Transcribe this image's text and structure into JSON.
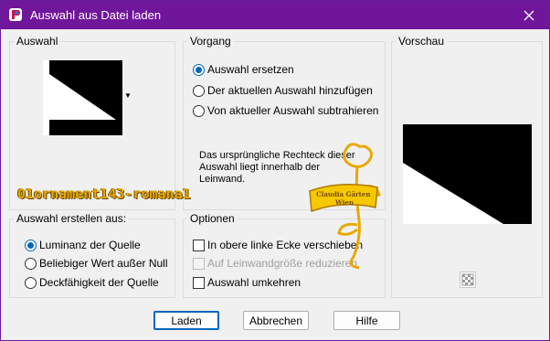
{
  "window": {
    "title": "Auswahl aus Datei laden"
  },
  "groups": {
    "auswahl": {
      "title": "Auswahl"
    },
    "vorgang": {
      "title": "Vorgang",
      "options": [
        {
          "label": "Auswahl ersetzen",
          "checked": true
        },
        {
          "label": "Der aktuellen Auswahl hinzufügen",
          "checked": false
        },
        {
          "label": "Von aktueller Auswahl subtrahieren",
          "checked": false
        }
      ],
      "info": "Das ursprüngliche Rechteck dieser Auswahl liegt innerhalb der Leinwand."
    },
    "vorschau": {
      "title": "Vorschau"
    },
    "erstellen": {
      "title": "Auswahl erstellen aus:",
      "options": [
        {
          "label": "Luminanz der Quelle",
          "checked": true
        },
        {
          "label": "Beliebiger Wert außer Null",
          "checked": false
        },
        {
          "label": "Deckfähigkeit der Quelle",
          "checked": false
        }
      ]
    },
    "optionen": {
      "title": "Optionen",
      "checks": [
        {
          "label": "In obere linke Ecke verschieben",
          "checked": false,
          "disabled": false
        },
        {
          "label": "Auf Leinwandgröße reduzieren",
          "checked": false,
          "disabled": true
        },
        {
          "label": "Auswahl umkehren",
          "checked": false,
          "disabled": false
        }
      ]
    }
  },
  "selected_file": "01ornament143-romana1",
  "watermark": "Claudia Gärten Wien",
  "buttons": {
    "load": "Laden",
    "cancel": "Abbrechen",
    "help": "Hilfe"
  },
  "colors": {
    "titlebar": "#70169b",
    "accent": "#0067c0",
    "watermark": "#e8a800"
  }
}
